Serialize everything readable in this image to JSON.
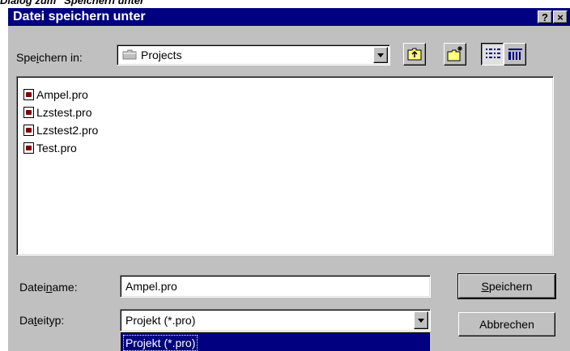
{
  "caption": "Dialog zum \"Speichern unter\"",
  "dialog": {
    "title": "Datei speichern unter",
    "help_button": "?",
    "close_button": "×"
  },
  "save_in": {
    "label_pre": "Spe",
    "label_accel": "i",
    "label_post": "chern in:",
    "value": "Projects"
  },
  "toolbar": {
    "icons": [
      "up-one-level-icon",
      "new-folder-icon",
      "list-view-icon",
      "details-view-icon"
    ]
  },
  "files": [
    {
      "name": "Ampel.pro",
      "icon": "project-file-icon"
    },
    {
      "name": "Lzstest.pro",
      "icon": "project-file-icon"
    },
    {
      "name": "Lzstest2.pro",
      "icon": "project-file-icon"
    },
    {
      "name": "Test.pro",
      "icon": "project-file-icon"
    }
  ],
  "filename": {
    "label_pre": "Datei",
    "label_accel": "n",
    "label_post": "ame:",
    "value": "Ampel.pro"
  },
  "filetype": {
    "label_pre": "Da",
    "label_accel": "t",
    "label_post": "eityp:",
    "value": "Projekt (*.pro)",
    "dropdown_option": "Projekt (*.pro)"
  },
  "buttons": {
    "save_accel": "S",
    "save_rest": "peichern",
    "cancel": "Abbrechen"
  },
  "colors": {
    "titlebar": "#000080",
    "face": "#c0c0c0",
    "selection": "#000080"
  }
}
